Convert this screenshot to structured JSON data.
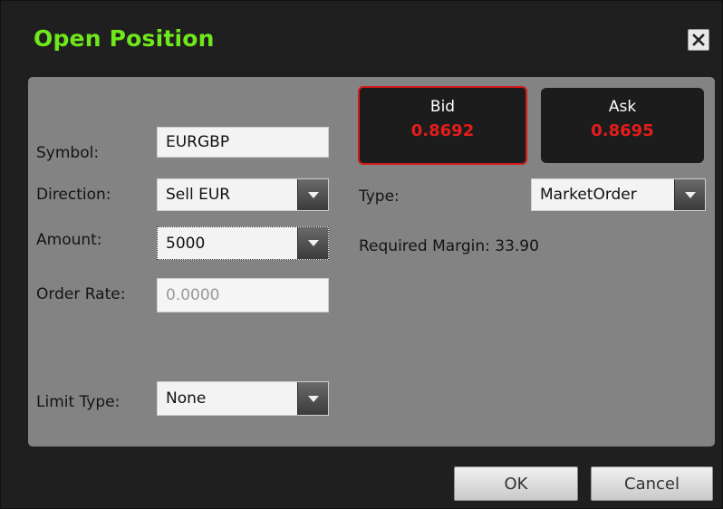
{
  "dialog": {
    "title": "Open Position",
    "close_icon": "close-icon"
  },
  "form": {
    "symbol": {
      "label": "Symbol:",
      "value": "EURGBP"
    },
    "direction": {
      "label": "Direction:",
      "value": "Sell EUR"
    },
    "amount": {
      "label": "Amount:",
      "value": "5000"
    },
    "order_rate": {
      "label": "Order Rate:",
      "placeholder": "0.0000"
    },
    "limit_type": {
      "label": "Limit Type:",
      "value": "None"
    },
    "type": {
      "label": "Type:",
      "value": "MarketOrder"
    },
    "required_margin": {
      "label": "Required Margin:",
      "value": "33.90"
    }
  },
  "quotes": {
    "bid": {
      "label": "Bid",
      "price": "0.8692"
    },
    "ask": {
      "label": "Ask",
      "price": "0.8695"
    }
  },
  "buttons": {
    "ok": "OK",
    "cancel": "Cancel"
  },
  "colors": {
    "title": "#6fe81b",
    "price": "#e51c1c",
    "bid_border": "#d11a1a",
    "panel": "#838383",
    "background": "#1f1f1f"
  }
}
